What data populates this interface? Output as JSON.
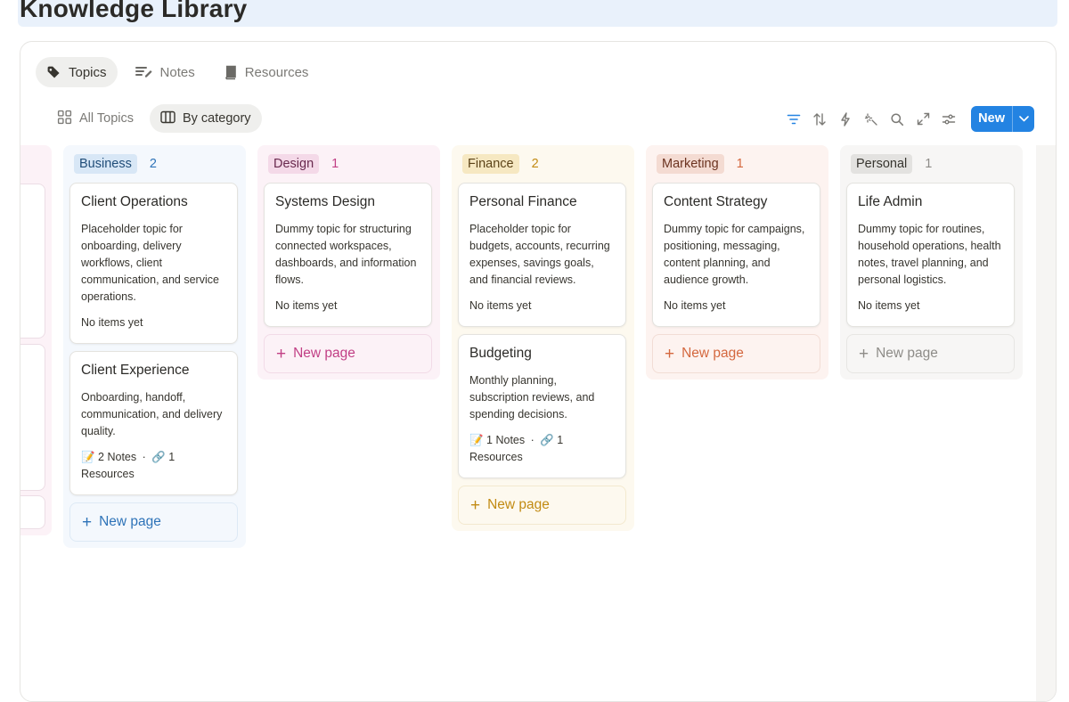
{
  "page": {
    "title": "Knowledge Library"
  },
  "view_tabs": [
    {
      "label": "Topics",
      "icon": "tag-icon",
      "active": true
    },
    {
      "label": "Notes",
      "icon": "notes-icon",
      "active": false
    },
    {
      "label": "Resources",
      "icon": "book-icon",
      "active": false
    }
  ],
  "subtabs": [
    {
      "label": "All Topics",
      "icon": "grid-icon",
      "active": false
    },
    {
      "label": "By category",
      "icon": "columns-icon",
      "active": true
    }
  ],
  "toolbar": {
    "icons": [
      "filter-icon",
      "sort-icon",
      "lightning-icon",
      "sparkle-icon",
      "search-icon",
      "expand-icon",
      "settings-icon"
    ],
    "new_label": "New",
    "accent": "#2383e2"
  },
  "new_page_label": "New page",
  "columns": [
    {
      "name": "Business",
      "count": "2",
      "colors": {
        "bg": "#f4f8fd",
        "badge_bg": "#d8e7f6",
        "badge_text": "#1f4c78",
        "count": "#2e73b8",
        "np_border": "#dde9f5",
        "np_bg": "#f4f8fd",
        "np_text": "#2e73b8"
      },
      "cards": [
        {
          "title": "Client Operations",
          "desc": "Placeholder topic for onboarding, delivery workflows, client communication, and service operations.",
          "meta": "No items yet"
        },
        {
          "title": "Client Experience",
          "desc": "Onboarding, handoff, communication, and delivery quality.",
          "notes": "📝 2 Notes",
          "resources_a": "🔗 1",
          "resources_b": "Resources"
        }
      ]
    },
    {
      "name": "Design",
      "count": "1",
      "colors": {
        "bg": "#fcf2f7",
        "badge_bg": "#f4d9e8",
        "badge_text": "#69294e",
        "count": "#c13f85",
        "np_border": "#f2dbe7",
        "np_bg": "#fcf2f7",
        "np_text": "#c13f85"
      },
      "cards": [
        {
          "title": "Systems Design",
          "desc": "Dummy topic for structuring connected workspaces, dashboards, and information flows.",
          "meta": "No items yet"
        }
      ]
    },
    {
      "name": "Finance",
      "count": "2",
      "colors": {
        "bg": "#fdf9ef",
        "badge_bg": "#f6e8c2",
        "badge_text": "#5c4317",
        "count": "#c28b13",
        "np_border": "#f3e9cf",
        "np_bg": "#fdf9ef",
        "np_text": "#c28b13"
      },
      "cards": [
        {
          "title": "Personal Finance",
          "desc": "Placeholder topic for budgets, accounts, recurring expenses, savings goals, and financial reviews.",
          "meta": "No items yet"
        },
        {
          "title": "Budgeting",
          "desc": "Monthly planning, subscription reviews, and spending decisions.",
          "notes": "📝 1 Notes",
          "resources_a": "🔗 1",
          "resources_b": "Resources"
        }
      ]
    },
    {
      "name": "Marketing",
      "count": "1",
      "colors": {
        "bg": "#fdf3f0",
        "badge_bg": "#f4dbd2",
        "badge_text": "#6c3320",
        "count": "#d4683f",
        "np_border": "#f2ddd5",
        "np_bg": "#fdf3f0",
        "np_text": "#d4683f"
      },
      "cards": [
        {
          "title": "Content Strategy",
          "desc": "Dummy topic for campaigns, positioning, messaging, content planning, and audience growth.",
          "meta": "No items yet"
        }
      ]
    },
    {
      "name": "Personal",
      "count": "1",
      "colors": {
        "bg": "#f7f6f5",
        "badge_bg": "#e3e2e0",
        "badge_text": "#37352f",
        "count": "#8e8c88",
        "np_border": "#e7e6e3",
        "np_bg": "#f7f6f5",
        "np_text": "#8e8c88"
      },
      "cards": [
        {
          "title": "Life Admin",
          "desc": "Dummy topic for routines, household operations, health notes, travel planning, and personal logistics.",
          "meta": "No items yet"
        }
      ]
    }
  ]
}
